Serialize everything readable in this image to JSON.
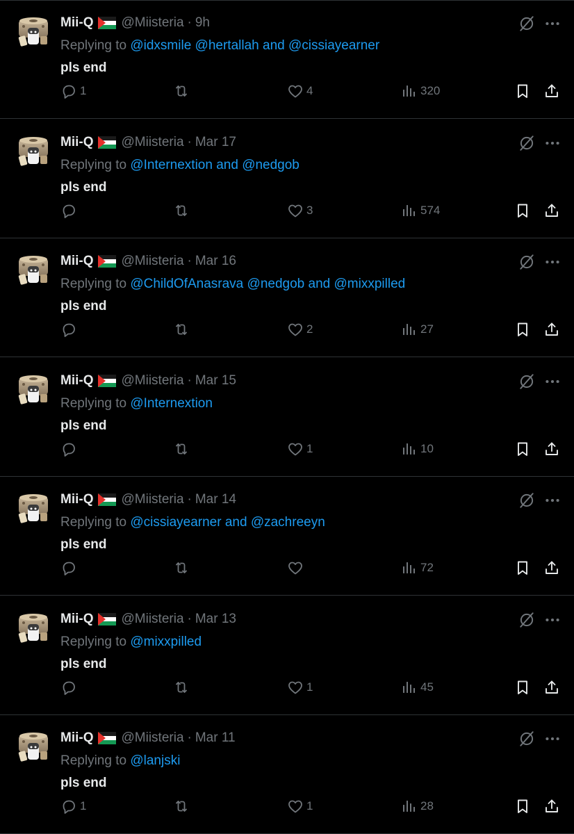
{
  "colors": {
    "background": "#000000",
    "text": "#e7e9ea",
    "muted": "#71767b",
    "link": "#1d9bf0",
    "divider": "#2f3336"
  },
  "tweets": [
    {
      "display_name": "Mii-Q",
      "handle": "@Miisteria",
      "separator": "·",
      "time": "9h",
      "replying_prefix": "Replying to",
      "reply_parts": [
        {
          "text": "@idxsmile",
          "kind": "mention"
        },
        {
          "text": " ",
          "kind": "space"
        },
        {
          "text": "@hertallah",
          "kind": "mention"
        },
        {
          "text": " and ",
          "kind": "and"
        },
        {
          "text": "@cissiayearner",
          "kind": "mention"
        }
      ],
      "text": "pls end",
      "replies": "1",
      "retweets": "",
      "likes": "4",
      "views": "320"
    },
    {
      "display_name": "Mii-Q",
      "handle": "@Miisteria",
      "separator": "·",
      "time": "Mar 17",
      "replying_prefix": "Replying to",
      "reply_parts": [
        {
          "text": "@Internextion",
          "kind": "mention"
        },
        {
          "text": " and ",
          "kind": "and"
        },
        {
          "text": "@nedgob",
          "kind": "mention"
        }
      ],
      "text": "pls end",
      "replies": "",
      "retweets": "",
      "likes": "3",
      "views": "574"
    },
    {
      "display_name": "Mii-Q",
      "handle": "@Miisteria",
      "separator": "·",
      "time": "Mar 16",
      "replying_prefix": "Replying to",
      "reply_parts": [
        {
          "text": "@ChildOfAnasrava",
          "kind": "mention"
        },
        {
          "text": " ",
          "kind": "space"
        },
        {
          "text": "@nedgob",
          "kind": "mention"
        },
        {
          "text": " and ",
          "kind": "and"
        },
        {
          "text": "@mixxpilled",
          "kind": "mention"
        }
      ],
      "text": "pls end",
      "replies": "",
      "retweets": "",
      "likes": "2",
      "views": "27"
    },
    {
      "display_name": "Mii-Q",
      "handle": "@Miisteria",
      "separator": "·",
      "time": "Mar 15",
      "replying_prefix": "Replying to",
      "reply_parts": [
        {
          "text": "@Internextion",
          "kind": "mention"
        }
      ],
      "text": "pls end",
      "replies": "",
      "retweets": "",
      "likes": "1",
      "views": "10"
    },
    {
      "display_name": "Mii-Q",
      "handle": "@Miisteria",
      "separator": "·",
      "time": "Mar 14",
      "replying_prefix": "Replying to",
      "reply_parts": [
        {
          "text": "@cissiayearner",
          "kind": "mention"
        },
        {
          "text": " and ",
          "kind": "and"
        },
        {
          "text": "@zachreeyn",
          "kind": "mention"
        }
      ],
      "text": "pls end",
      "replies": "",
      "retweets": "",
      "likes": "",
      "views": "72"
    },
    {
      "display_name": "Mii-Q",
      "handle": "@Miisteria",
      "separator": "·",
      "time": "Mar 13",
      "replying_prefix": "Replying to",
      "reply_parts": [
        {
          "text": "@mixxpilled",
          "kind": "mention"
        }
      ],
      "text": "pls end",
      "replies": "",
      "retweets": "",
      "likes": "1",
      "views": "45"
    },
    {
      "display_name": "Mii-Q",
      "handle": "@Miisteria",
      "separator": "·",
      "time": "Mar 11",
      "replying_prefix": "Replying to",
      "reply_parts": [
        {
          "text": "@lanjski",
          "kind": "mention"
        }
      ],
      "text": "pls end",
      "replies": "1",
      "retweets": "",
      "likes": "1",
      "views": "28"
    }
  ],
  "icons": {
    "grok": "grok-icon",
    "more": "more-icon",
    "reply": "reply-icon",
    "retweet": "retweet-icon",
    "like": "heart-icon",
    "views": "views-icon",
    "bookmark": "bookmark-icon",
    "share": "share-icon",
    "flag": "palestine-flag-icon"
  }
}
